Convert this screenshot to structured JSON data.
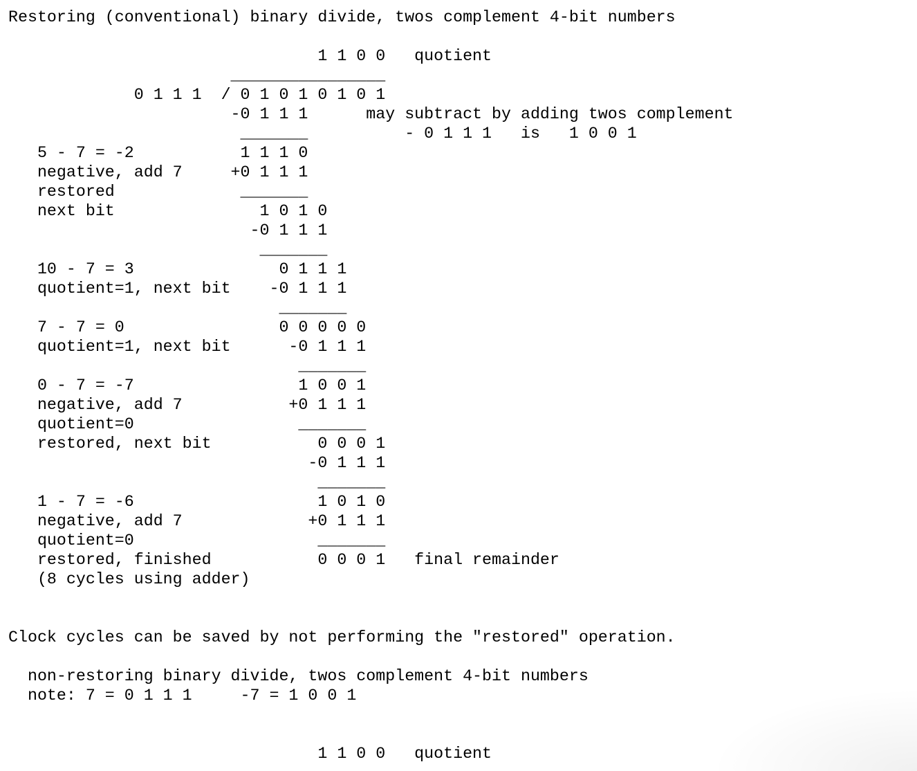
{
  "document": {
    "lines": [
      "Restoring (conventional) binary divide, twos complement 4-bit numbers",
      "",
      "                                1 1 0 0   quotient",
      "                       ________________",
      "             0 1 1 1  / 0 1 0 1 0 1 0 1",
      "                       -0 1 1 1      may subtract by adding twos complement",
      "                        _______          - 0 1 1 1   is   1 0 0 1",
      "   5 - 7 = -2           1 1 1 0",
      "   negative, add 7     +0 1 1 1",
      "   restored             _______",
      "   next bit               1 0 1 0",
      "                         -0 1 1 1",
      "                          _______",
      "   10 - 7 = 3               0 1 1 1",
      "   quotient=1, next bit    -0 1 1 1",
      "                            _______",
      "   7 - 7 = 0                0 0 0 0 0",
      "   quotient=1, next bit      -0 1 1 1",
      "                              _______",
      "   0 - 7 = -7                 1 0 0 1",
      "   negative, add 7           +0 1 1 1",
      "   quotient=0                 _______",
      "   restored, next bit           0 0 0 1",
      "                               -0 1 1 1",
      "                                _______",
      "   1 - 7 = -6                   1 0 1 0",
      "   negative, add 7             +0 1 1 1",
      "   quotient=0                   _______",
      "   restored, finished           0 0 0 1   final remainder",
      "   (8 cycles using adder)",
      "",
      "",
      "Clock cycles can be saved by not performing the \"restored\" operation.",
      "",
      "  non-restoring binary divide, twos complement 4-bit numbers",
      "  note: 7 = 0 1 1 1     -7 = 1 0 0 1",
      "",
      "",
      "                                1 1 0 0   quotient"
    ]
  }
}
